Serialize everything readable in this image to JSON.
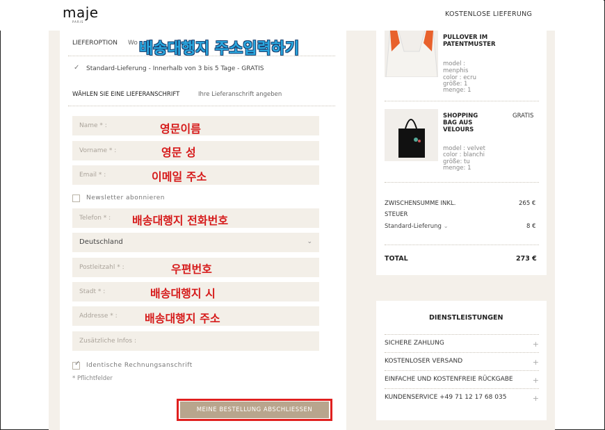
{
  "header": {
    "logo": "maje",
    "logo_sub": "PARIS",
    "shipping_note": "KOSTENLOSE LIEFERUNG"
  },
  "delivery": {
    "option_label": "LIEFEROPTION",
    "option_partial": "Wo",
    "option_partial_end": "t",
    "standard_option": "Standard-Lieferung - Innerhalb von 3 bis 5 Tage - GRATIS",
    "address_heading": "WÄHLEN SIE EINE LIEFERANSCHRIFT",
    "address_hint": "Ihre Lieferanschrift angeben"
  },
  "form": {
    "name_ph": "Name * :",
    "vorname_ph": "Vorname * :",
    "email_ph": "Email * :",
    "newsletter": "Newsletter abonnieren",
    "telefon_ph": "Telefon * :",
    "country_value": "Deutschland",
    "plz_ph": "Postleitzahl * :",
    "stadt_ph": "Stadt * :",
    "adresse_ph": "Addresse * :",
    "zusatz_ph": "Zusätzliche Infos :",
    "billing_same": "Identische Rechnungsanschrift",
    "required_note": "* Pflichtfelder",
    "submit": "MEINE BESTELLUNG ABSCHLIESSEN"
  },
  "annotations": {
    "title": "배송대행지 주소입력하기",
    "name": "영문이름",
    "vorname": "영문 성",
    "email": "이메일 주소",
    "telefon": "배송대행지 전화번호",
    "plz": "우편번호",
    "stadt": "배송대행지 시",
    "adresse": "배송대행지 주소"
  },
  "cart": {
    "items": [
      {
        "title_line1": "PULLOVER IM",
        "title_line2": "PATENTMUSTER",
        "model": "model :",
        "model_val": "menphis",
        "color": "color : ecru",
        "size": "größe: 1",
        "qty": "menge: 1",
        "price": ""
      },
      {
        "title_line1": "SHOPPING",
        "title_line2": "BAG AUS",
        "title_line3": "VELOURS",
        "model": "model : velvet",
        "color": "color : blanchi",
        "size": "größe: tu",
        "qty": "menge: 1",
        "price": "GRATIS"
      }
    ],
    "subtotal_label_1": "ZWISCHENSUMME INKL.",
    "subtotal_label_2": "STEUER",
    "subtotal_value": "265 €",
    "shipping_label": "Standard-Lieferung",
    "shipping_value": "8 €",
    "total_label": "TOTAL",
    "total_value": "273 €"
  },
  "services": {
    "title": "DIENSTLEISTUNGEN",
    "items": [
      "SICHERE ZAHLUNG",
      "KOSTENLOSER VERSAND",
      "EINFACHE UND KOSTENFREIE RÜCKGABE",
      "KUNDENSERVICE +49 71 12 17 68 035"
    ]
  },
  "colors": {
    "accent_button": "#b8a58d",
    "highlight_border": "#e0201f",
    "annotation_red": "#d61b1b",
    "annotation_blue": "#2aa8e0",
    "beige_bg": "#f4f0ea"
  }
}
